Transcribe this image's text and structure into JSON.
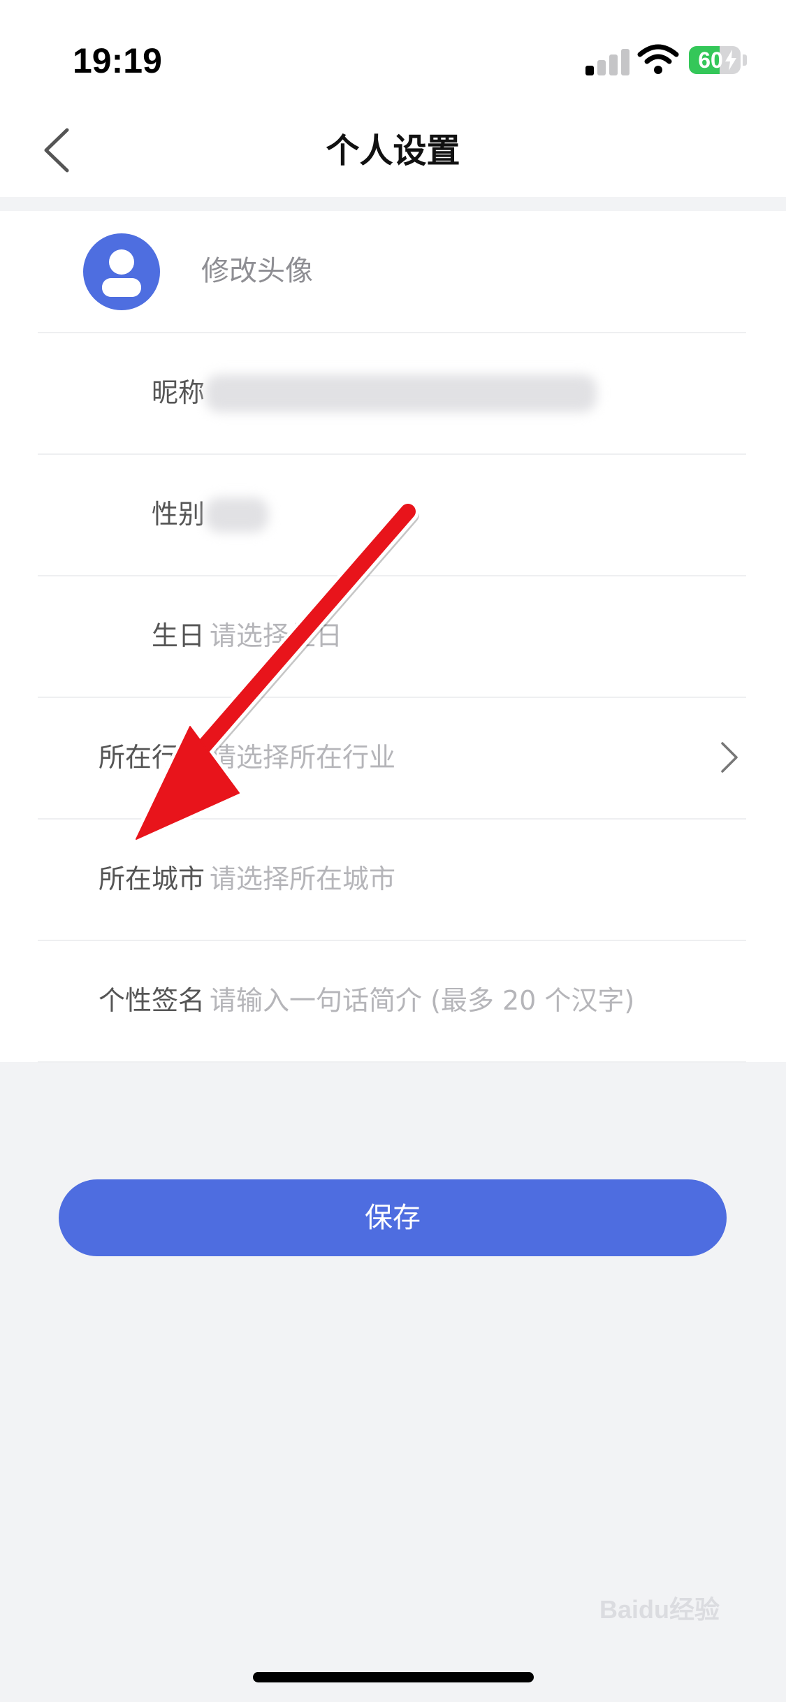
{
  "status_bar": {
    "time": "19:19",
    "battery": "60",
    "battery_level": 0.6
  },
  "nav": {
    "title": "个人设置"
  },
  "profile": {
    "avatar_action": "修改头像",
    "rows": [
      {
        "label": "昵称",
        "value": ""
      },
      {
        "label": "性别",
        "value": ""
      },
      {
        "label": "生日",
        "value": "请选择生日"
      },
      {
        "label": "所在行业",
        "value": "请选择所在行业"
      },
      {
        "label": "所在城市",
        "value": "请选择所在城市"
      },
      {
        "label": "个性签名",
        "value": "请输入一句话简介 (最多 20 个汉字)"
      }
    ]
  },
  "save_label": "保存",
  "watermark": {
    "text": "Baidu经验"
  },
  "colors": {
    "accent": "#4e6de0",
    "annotation_arrow": "#e8141b",
    "battery": "#34c759"
  }
}
